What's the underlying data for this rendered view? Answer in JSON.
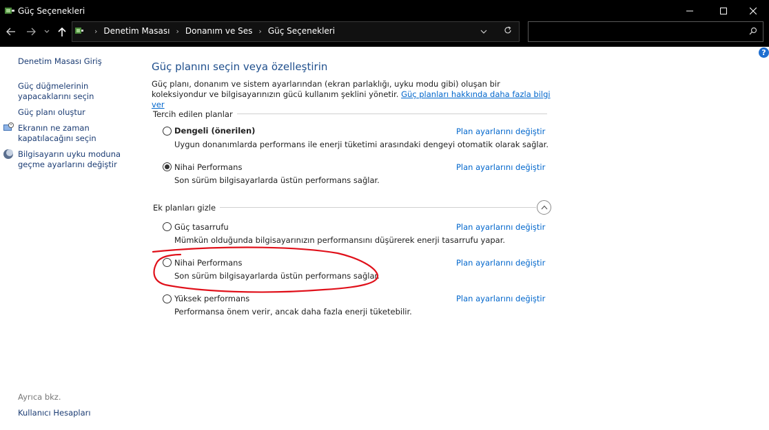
{
  "window": {
    "title": "Güç Seçenekleri"
  },
  "breadcrumb": [
    "Denetim Masası",
    "Donanım ve Ses",
    "Güç Seçenekleri"
  ],
  "search": {
    "placeholder": "",
    "value": ""
  },
  "sidebar": {
    "links": [
      "Denetim Masası Giriş",
      "Güç düğmelerinin yapacaklarını seçin",
      "Güç planı oluştur",
      "Ekranın ne zaman kapatılacağını seçin",
      "Bilgisayarın uyku moduna geçme ayarlarını değiştir"
    ],
    "see_also_title": "Ayrıca bkz.",
    "see_also_links": [
      "Kullanıcı Hesapları"
    ]
  },
  "main": {
    "heading": "Güç planını seçin veya özelleştirin",
    "description": "Güç planı, donanım ve sistem ayarlarından (ekran parlaklığı, uyku modu gibi) oluşan bir koleksiyondur ve bilgisayarınızın gücü kullanım şeklini yönetir.",
    "description_link": "Güç planları hakkında daha fazla bilgi ver",
    "preferred_title": "Tercih edilen planlar",
    "hidden_title": "Ek planları gizle",
    "change_link": "Plan ayarlarını değiştir",
    "preferred_plans": [
      {
        "name": "Dengeli (önerilen)",
        "desc": "Uygun donanımlarda performans ile enerji tüketimi arasındaki dengeyi otomatik olarak sağlar.",
        "selected": false
      },
      {
        "name": "Nihai Performans",
        "desc": "Son sürüm bilgisayarlarda üstün performans sağlar.",
        "selected": true
      }
    ],
    "additional_plans": [
      {
        "name": "Güç tasarrufu",
        "desc": "Mümkün olduğunda bilgisayarınızın performansını düşürerek enerji tasarrufu yapar.",
        "selected": false
      },
      {
        "name": "Nihai Performans",
        "desc": "Son sürüm bilgisayarlarda üstün performans sağlar.",
        "selected": false
      },
      {
        "name": "Yüksek performans",
        "desc": "Performansa önem verir, ancak daha fazla enerji tüketebilir.",
        "selected": false
      }
    ]
  },
  "colors": {
    "link": "#0066cc",
    "heading": "#1e4e8c",
    "annotation": "#e0101a",
    "titlebar": "#000000"
  }
}
